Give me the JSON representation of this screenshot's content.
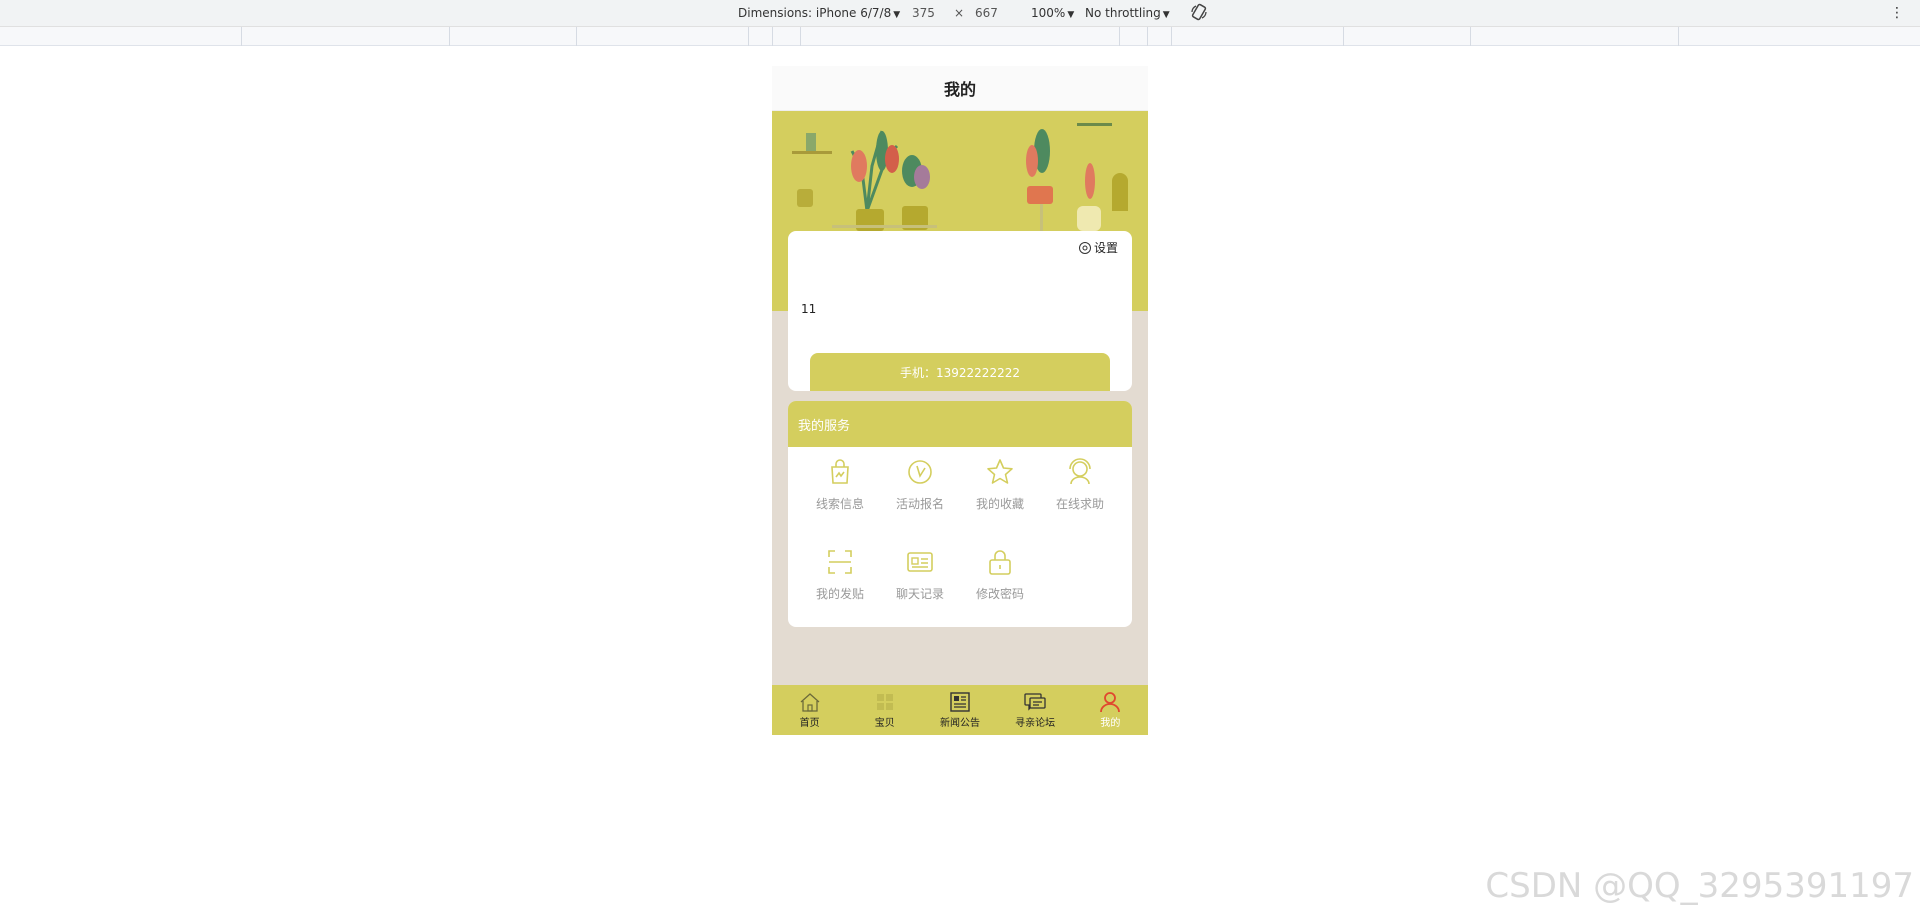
{
  "devtools": {
    "dimensions_label": "Dimensions: iPhone 6/7/8",
    "width": "375",
    "times": "×",
    "height": "667",
    "zoom": "100%",
    "throttling": "No throttling"
  },
  "header": {
    "title": "我的"
  },
  "profile": {
    "settings_label": "设置",
    "username": "11",
    "phone": "手机：13922222222"
  },
  "services": {
    "title": "我的服务",
    "items": [
      {
        "label": "线索信息",
        "icon": "bag-icon"
      },
      {
        "label": "活动报名",
        "icon": "clock-icon"
      },
      {
        "label": "我的收藏",
        "icon": "star-icon"
      },
      {
        "label": "在线求助",
        "icon": "headset-icon"
      },
      {
        "label": "我的发贴",
        "icon": "scan-icon"
      },
      {
        "label": "聊天记录",
        "icon": "id-card-icon"
      },
      {
        "label": "修改密码",
        "icon": "lock-icon"
      }
    ]
  },
  "tabs": [
    {
      "label": "首页",
      "icon": "home-icon"
    },
    {
      "label": "宝贝",
      "icon": "grid-icon"
    },
    {
      "label": "新闻公告",
      "icon": "newspaper-icon"
    },
    {
      "label": "寻亲论坛",
      "icon": "chat-icon"
    },
    {
      "label": "我的",
      "icon": "user-icon",
      "active": true
    }
  ],
  "colors": {
    "accent": "#d4ce5e",
    "page_bg": "#e3dbd1",
    "active_tab_icon": "#e0482f"
  },
  "watermark": "CSDN @QQ_3295391197"
}
